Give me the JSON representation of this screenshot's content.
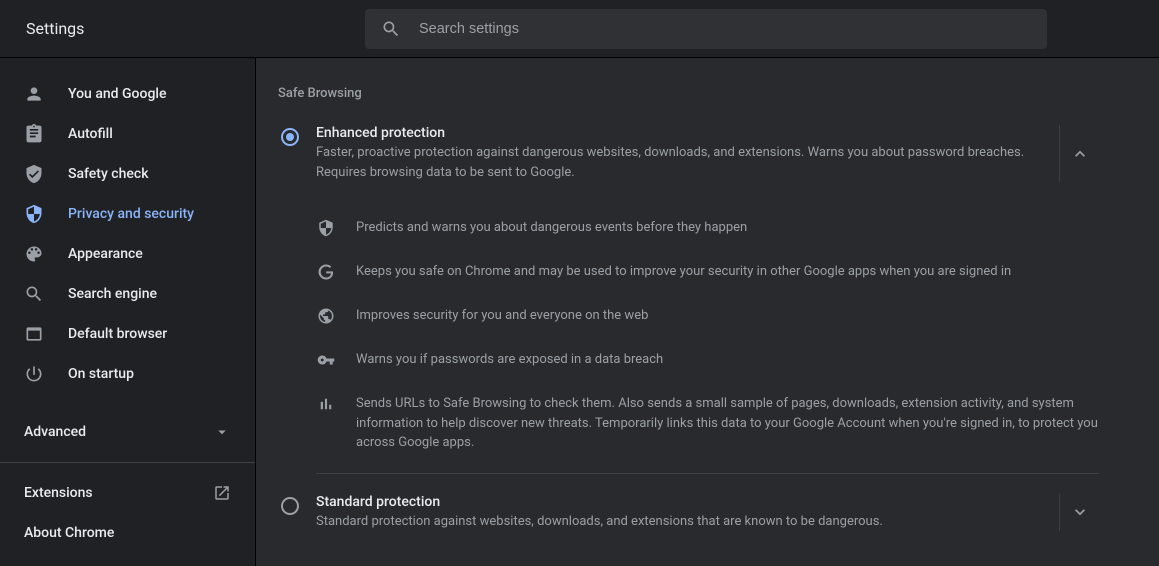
{
  "header": {
    "title": "Settings",
    "search_placeholder": "Search settings"
  },
  "sidebar": {
    "items": [
      {
        "label": "You and Google"
      },
      {
        "label": "Autofill"
      },
      {
        "label": "Safety check"
      },
      {
        "label": "Privacy and security"
      },
      {
        "label": "Appearance"
      },
      {
        "label": "Search engine"
      },
      {
        "label": "Default browser"
      },
      {
        "label": "On startup"
      }
    ],
    "advanced_label": "Advanced",
    "extensions_label": "Extensions",
    "about_label": "About Chrome"
  },
  "content": {
    "section_title": "Safe Browsing",
    "enhanced": {
      "title": "Enhanced protection",
      "desc": "Faster, proactive protection against dangerous websites, downloads, and extensions. Warns you about password breaches. Requires browsing data to be sent to Google.",
      "bullets": [
        "Predicts and warns you about dangerous events before they happen",
        "Keeps you safe on Chrome and may be used to improve your security in other Google apps when you are signed in",
        "Improves security for you and everyone on the web",
        "Warns you if passwords are exposed in a data breach",
        "Sends URLs to Safe Browsing to check them. Also sends a small sample of pages, downloads, extension activity, and system information to help discover new threats. Temporarily links this data to your Google Account when you're signed in, to protect you across Google apps."
      ]
    },
    "standard": {
      "title": "Standard protection",
      "desc": "Standard protection against websites, downloads, and extensions that are known to be dangerous."
    }
  }
}
